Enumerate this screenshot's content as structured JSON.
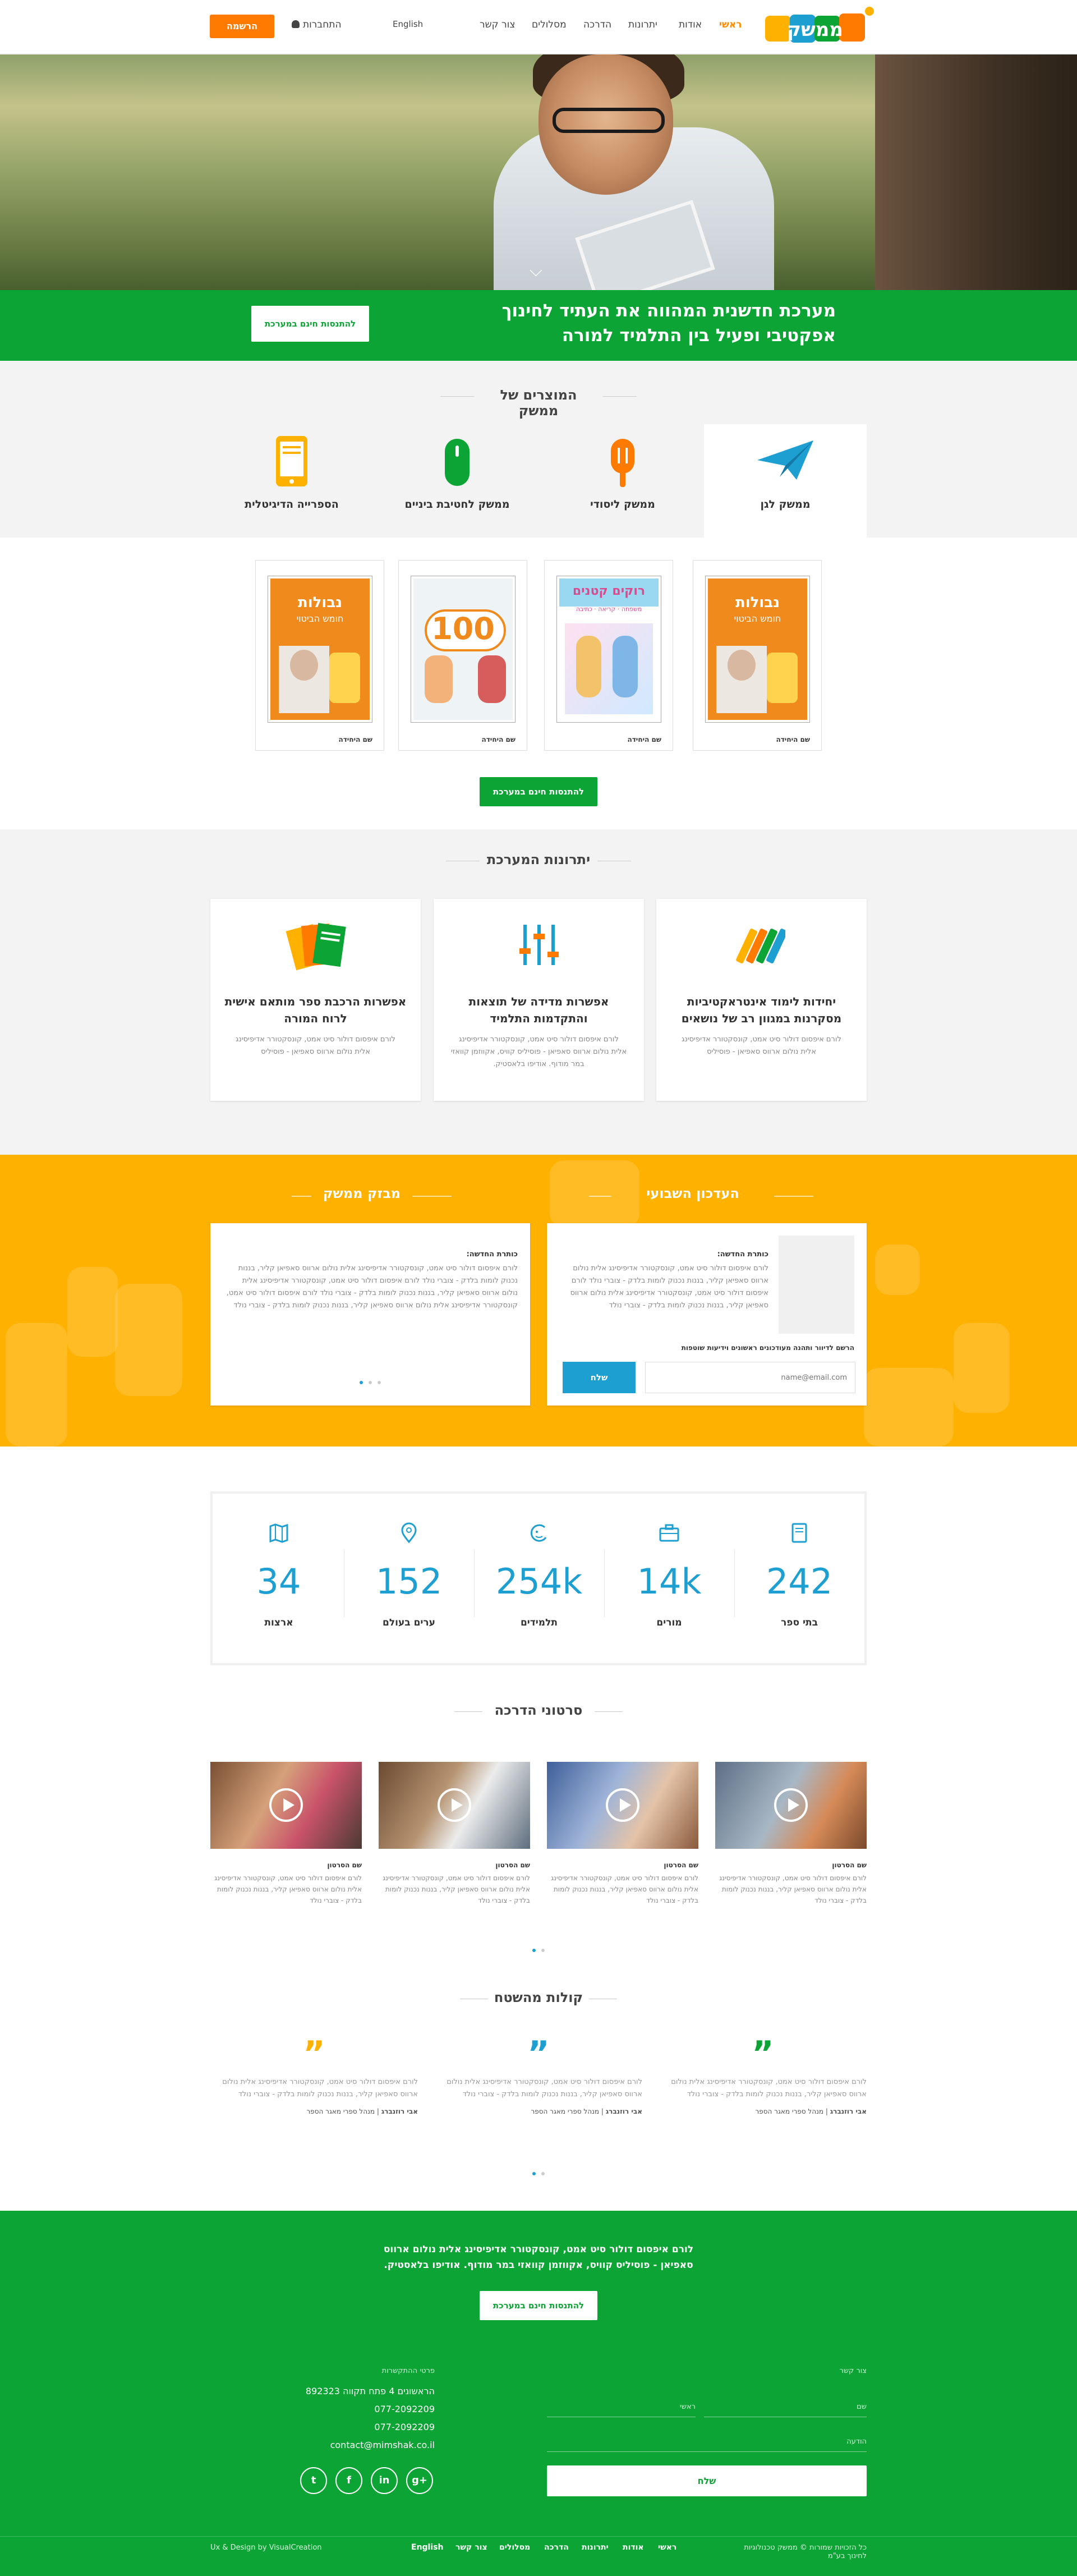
{
  "header": {
    "logo_text": "ממשק",
    "nav": [
      "ראשי",
      "אודות",
      "יתרונות",
      "הדרכה",
      "מסלולים",
      "צור קשר",
      "English"
    ],
    "login": "התחברות",
    "signup": "הרשמה"
  },
  "hero": {
    "line1": "מערכת חדשנית המהווה את העתיד לחינוך",
    "line2": "אפקטיבי ופעיל בין התלמיד למורה",
    "cta": "להתנסות חינם במערכת"
  },
  "products": {
    "title": "המוצרים של ממשק",
    "items": [
      "ממשק לגן",
      "ממשק ליסודי",
      "ממשק לחטיבת ביניים",
      "הספרייה הדיגיטלית"
    ],
    "books": [
      {
        "cover_title": "נבולות",
        "cover_sub": "חומש הביטוי",
        "caption": "שם היחידה"
      },
      {
        "cover_title": "רוקים קטנים",
        "cover_sub": "משפחה · קריאה · כתיבה",
        "caption": "שם היחידה"
      },
      {
        "cover_title": "100",
        "cover_sub": "",
        "caption": "שם היחידה"
      },
      {
        "cover_title": "נבולות",
        "cover_sub": "חומש הביטוי",
        "caption": "שם היחידה"
      }
    ],
    "cta": "להתנסות חינם במערכת"
  },
  "advantages": {
    "title": "יתרונות המערכת",
    "items": [
      {
        "title": "יחידות לימוד אינטראקטיביות מסקרנות במגוון רב של נושאים",
        "body": "לורם איפסום דולור סיט אמט, קונסקטורר אדיפיסינג אלית נולום ארווס סאפיאן - פוסיליס"
      },
      {
        "title": "אפשרות מדידה של תוצאות והתקדמות התלמיד",
        "body": "לורם איפסום דולור סיט אמט, קונסקטורר אדיפיסינג אלית נולום ארווס סאפיאן - פוסיליס קוויס, אקווזמן קוואזי במר מודוף. אודיפו בלאסטיק."
      },
      {
        "title": "אפשרות הרכבת ספר מותאם אישית לרוח המורה",
        "body": "לורם איפסום דולור סיט אמט, קונסקטורר אדיפיסינג אלית נולום ארווס סאפיאן - פוסיליס"
      }
    ]
  },
  "newsletter": {
    "title": "העדכון השבועי",
    "item_title": "כותרת החדשה:",
    "item_body": "לורם איפסום דולור סיט אמט, קונסקטורר אדיפיסינג אלית נולום ארווס סאפיאן קליר, בננות נכנוק לומות בלדק - צוברי נולד לורם איפסום דולור סיט אמט, קונסקטורר אדיפיסינג אלית נולום ארווס סאפיאן קליר, בננות נכנוק לומות בלדק - צוברי נולד",
    "signup_text": "הרשם לדיוור ותהנה מעודכונים ראשונים וידיעות שוטפות",
    "email_placeholder": "name@email.com",
    "send": "שלח"
  },
  "spotlight": {
    "title": "מבזק ממשק",
    "item_title": "כותרת החדשה:",
    "item_body": "לורם איפסום דולור סיט אמט, קונסקטורר אדיפיסינג אלית נולום ארווס סאפיאן קליר, בננות נכנוק לומות בלדק - צוברי נולד לורם איפסום דולור סיט אמט, קונסקטורר אדיפיסינג אלית נולום ארווס סאפיאן קליר, בננות נכנוק לומות בלדק - צוברי נולד לורם איפסום דולור סיט אמט, קונסקטורר אדיפיסינג אלית נולום ארווס סאפיאן קליר, בננות נכנוק לומות בלדק - צוברי נולד"
  },
  "stats": [
    {
      "value": "242",
      "label": "בתי ספר",
      "icon": "book-icon"
    },
    {
      "value": "14k",
      "label": "מורים",
      "icon": "briefcase-icon"
    },
    {
      "value": "254k",
      "label": "תלמידים",
      "icon": "face-icon"
    },
    {
      "value": "152",
      "label": "ערים בעולם",
      "icon": "location-pin-icon"
    },
    {
      "value": "34",
      "label": "ארצות",
      "icon": "map-icon"
    }
  ],
  "videos": {
    "title": "סרטוני הדרכה",
    "items": [
      {
        "title": "שם הסרטון",
        "body": "לורם איפסום דולור סיט אמט, קונסקטורר אדיפיסינג אלית נולום ארווס סאפיאן קליר, בננות נכנוק לומות בלדק - צוברי נולד"
      },
      {
        "title": "שם הסרטון",
        "body": "לורם איפסום דולור סיט אמט, קונסקטורר אדיפיסינג אלית נולום ארווס סאפיאן קליר, בננות נכנוק לומות בלדק - צוברי נולד"
      },
      {
        "title": "שם הסרטון",
        "body": "לורם איפסום דולור סיט אמט, קונסקטורר אדיפיסינג אלית נולום ארווס סאפיאן קליר, בננות נכנוק לומות בלדק - צוברי נולד"
      },
      {
        "title": "שם הסרטון",
        "body": "לורם איפסום דולור סיט אמט, קונסקטורר אדיפיסינג אלית נולום ארווס סאפיאן קליר, בננות נכנוק לומות בלדק - צוברי נולד"
      }
    ]
  },
  "testimonials": {
    "title": "קולות מהשטח",
    "items": [
      {
        "body": "לורם איפסום דולור סיט אמט, קונסקטורר אדיפיסינג אלית נולום ארווס סאפיאן קליר, בננות נכנוק לומות בלדק - צוברי נולד",
        "author": "אבי רוזנברג",
        "role": "מנהל ספרי מאגר הספר",
        "color": "#0ca535"
      },
      {
        "body": "לורם איפסום דולור סיט אמט, קונסקטורר אדיפיסינג אלית נולום ארווס סאפיאן קליר, בננות נכנוק לומות בלדק - צוברי נולד",
        "author": "אבי רוזנברג",
        "role": "מנהל ספרי מאגר הספר",
        "color": "#1e9fd2"
      },
      {
        "body": "לורם איפסום דולור סיט אמט, קונסקטורר אדיפיסינג אלית נולום ארווס סאפיאן קליר, בננות נכנוק לומות בלדק - צוברי נולד",
        "author": "אבי רוזנברג",
        "role": "מנהל ספרי מאגר הספר",
        "color": "#ffb100"
      }
    ]
  },
  "footer": {
    "cta_text_1": "לורם איפסום דולור סיט אמט, קונסקטורר אדיפיסינג אלית נולום ארווס",
    "cta_text_2": "סאפיאן - פוסיליס קוויס, אקווזמן קוואזי במר מודוף. אודיפו בלאסטיק.",
    "cta": "להתנסות חינם במערכת",
    "contact_title": "צור קשר",
    "name_label": "שם",
    "email_label": "ראשי",
    "message_label": "הודעה",
    "send": "שלח",
    "details_title": "פרטי ההתקשרות",
    "address": "הראשונים 4 פתח תקווה 892323",
    "phone": "077-2092209",
    "fax": "077-2092209",
    "email": "contact@mimshak.co.il",
    "social": [
      "twitter",
      "facebook",
      "linkedin",
      "google-plus"
    ],
    "nav": [
      "ראשי",
      "אודות",
      "יתרונות",
      "הדרכה",
      "מסלולים",
      "צור קשר",
      "English"
    ],
    "credit": "Ux & Design by VisualCreation",
    "copyright": "כל הזכויות שמורות © ממשק טכנולוגיות לחינוך בע\"מ"
  },
  "colors": {
    "brand_green": "#0ca535",
    "brand_orange": "#ff7a00",
    "accent_yellow": "#ffb100",
    "accent_blue": "#1e9fd2"
  }
}
